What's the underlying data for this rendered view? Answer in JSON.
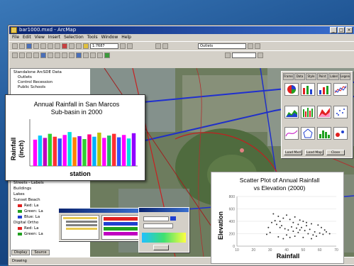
{
  "window": {
    "title": "bar1000.mxd - ArcMap",
    "menus": [
      "File",
      "Edit",
      "View",
      "Insert",
      "Selection",
      "Tools",
      "Window",
      "Help"
    ],
    "scale_value": "1:7687",
    "layer_combo": "Outlets",
    "status_text": "Drawing"
  },
  "toc": {
    "items": [
      {
        "label": "Standalone ArcSDE Data",
        "color": ""
      },
      {
        "label": "Outlets",
        "color": ""
      },
      {
        "label": "Control Recession",
        "color": ""
      },
      {
        "label": "Public Schools",
        "color": ""
      },
      {
        "label": "Streets - Labels",
        "color": ""
      },
      {
        "label": "Buildings",
        "color": ""
      },
      {
        "label": "Lakes",
        "color": ""
      },
      {
        "label": "Sunset Beach",
        "color": ""
      },
      {
        "label": "Red: La",
        "color": "#e02020"
      },
      {
        "label": "Green: La",
        "color": "#20a020"
      },
      {
        "label": "Blue: La",
        "color": "#2040d0"
      },
      {
        "label": "Digital Ortho",
        "color": ""
      },
      {
        "label": "Red: La",
        "color": "#e02020"
      },
      {
        "label": "Green: La",
        "color": "#20a020"
      }
    ],
    "tabs": [
      "Display",
      "Source"
    ]
  },
  "panel": {
    "tabs": [
      "Frame",
      "Data",
      "Style",
      "Point",
      "Label",
      "Legend"
    ],
    "buttons": [
      "Load Mxd",
      "Load Map",
      "Close"
    ]
  },
  "chart1": {
    "title_line1": "Annual Rainfall in San Marcos",
    "title_line2": "Sub-basin in 2000",
    "ylabel_line1": "Rainfall",
    "ylabel_line2": "(inch)",
    "xlabel": "station"
  },
  "chart2": {
    "title_line1": "Scatter Plot of Annual Rainfall",
    "title_line2": "vs Elevation (2000)",
    "ylabel": "Elevation",
    "xlabel": "Rainfall"
  },
  "chart_data": [
    {
      "type": "bar",
      "title": "Annual Rainfall in San Marcos Sub-basin in 2000",
      "xlabel": "station",
      "ylabel": "Rainfall (inch)",
      "values": [
        45,
        52,
        48,
        55,
        50,
        47,
        53,
        58,
        49,
        51,
        46,
        54,
        50,
        57,
        48,
        52,
        55,
        49,
        53,
        47,
        56
      ],
      "colors": [
        "#ff00ff",
        "#00c8ff",
        "#c000c0",
        "#30d030",
        "#ff3030",
        "#3050ff",
        "#ff00ff",
        "#00e0e0",
        "#ff8000",
        "#9000ff",
        "#30d030",
        "#ff0080",
        "#00b0ff",
        "#c0c000",
        "#ff00ff",
        "#20c060",
        "#ff3030",
        "#3050ff",
        "#ff00ff",
        "#00e0e0",
        "#9000ff"
      ],
      "ylim": [
        0,
        80
      ]
    },
    {
      "type": "scatter",
      "title": "Scatter Plot of Annual Rainfall vs Elevation (2000)",
      "xlabel": "Rainfall",
      "ylabel": "Elevation",
      "x_ticks": [
        "10",
        "20",
        "30",
        "40",
        "50",
        "60",
        "70"
      ],
      "y_ticks": [
        "0",
        "200",
        "400",
        "600",
        "800"
      ],
      "xlim": [
        10,
        70
      ],
      "ylim": [
        0,
        800
      ],
      "points": [
        [
          32,
          520
        ],
        [
          35,
          480
        ],
        [
          38,
          450
        ],
        [
          40,
          500
        ],
        [
          42,
          430
        ],
        [
          45,
          470
        ],
        [
          48,
          420
        ],
        [
          50,
          400
        ],
        [
          52,
          380
        ],
        [
          55,
          360
        ],
        [
          36,
          300
        ],
        [
          39,
          280
        ],
        [
          41,
          260
        ],
        [
          44,
          240
        ],
        [
          47,
          220
        ],
        [
          49,
          300
        ],
        [
          51,
          250
        ],
        [
          53,
          200
        ],
        [
          56,
          180
        ],
        [
          58,
          160
        ],
        [
          34,
          350
        ],
        [
          37,
          330
        ],
        [
          43,
          310
        ],
        [
          46,
          290
        ],
        [
          54,
          270
        ],
        [
          57,
          230
        ],
        [
          60,
          210
        ],
        [
          62,
          190
        ],
        [
          33,
          410
        ],
        [
          59,
          340
        ],
        [
          61,
          300
        ],
        [
          63,
          260
        ],
        [
          30,
          220
        ],
        [
          28,
          190
        ],
        [
          45,
          160
        ],
        [
          50,
          140
        ],
        [
          55,
          120
        ],
        [
          40,
          180
        ],
        [
          42,
          140
        ],
        [
          38,
          120
        ],
        [
          35,
          150
        ],
        [
          47,
          350
        ],
        [
          52,
          330
        ],
        [
          44,
          380
        ],
        [
          36,
          400
        ],
        [
          31,
          380
        ],
        [
          29,
          300
        ],
        [
          64,
          230
        ],
        [
          66,
          200
        ],
        [
          48,
          260
        ]
      ]
    }
  ]
}
